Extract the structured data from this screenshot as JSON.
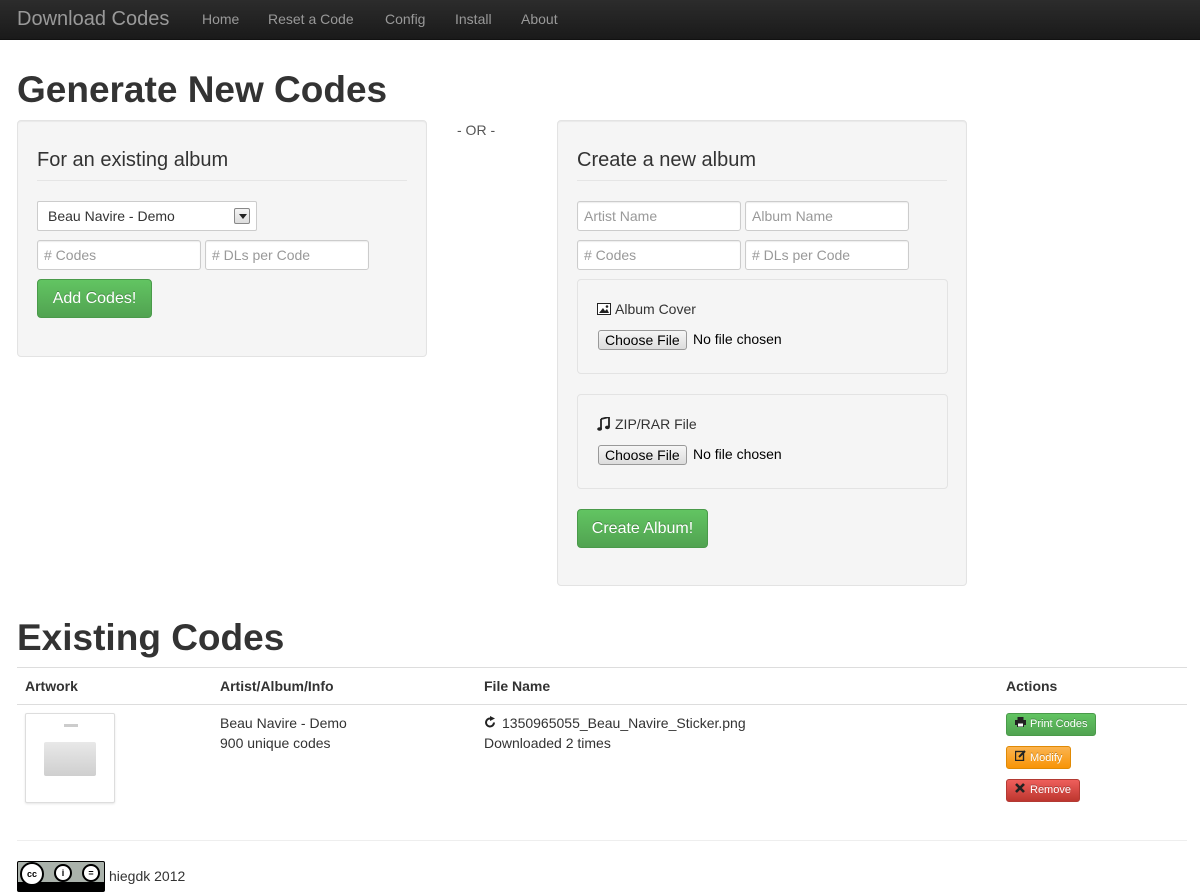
{
  "navbar": {
    "brand": "Download Codes",
    "items": [
      "Home",
      "Reset a Code",
      "Config",
      "Install",
      "About"
    ]
  },
  "generate": {
    "title": "Generate New Codes",
    "or_text": "- OR -",
    "existing": {
      "legend": "For an existing album",
      "selected_album": "Beau Navire - Demo",
      "codes_placeholder": "# Codes",
      "dls_placeholder": "# DLs per Code",
      "submit_label": "Add Codes!"
    },
    "new_album": {
      "legend": "Create a new album",
      "artist_placeholder": "Artist Name",
      "album_placeholder": "Album Name",
      "codes_placeholder": "# Codes",
      "dls_placeholder": "# DLs per Code",
      "cover_label": "Album Cover",
      "zip_label": "ZIP/RAR File",
      "choose_file_label": "Choose File",
      "no_file_text": "No file chosen",
      "submit_label": "Create Album!"
    }
  },
  "existing_codes": {
    "title": "Existing Codes",
    "columns": [
      "Artwork",
      "Artist/Album/Info",
      "File Name",
      "Actions"
    ],
    "rows": [
      {
        "album": "Beau Navire - Demo",
        "info": "900 unique codes",
        "file_name": "1350965055_Beau_Navire_Sticker.png",
        "downloads": "Downloaded 2 times",
        "actions": {
          "print": "Print Codes",
          "modify": "Modify",
          "remove": "Remove"
        }
      }
    ]
  },
  "footer": {
    "text": "hiegdk 2012"
  },
  "colors": {
    "navbar": "#1f1f1f",
    "success": "#5bb75b",
    "warning": "#faa732",
    "danger": "#da4f49"
  },
  "icons": {
    "cover": "picture-icon",
    "zip": "music-icon",
    "file": "share-icon",
    "print": "print-icon",
    "modify": "edit-icon",
    "remove": "remove-icon"
  }
}
